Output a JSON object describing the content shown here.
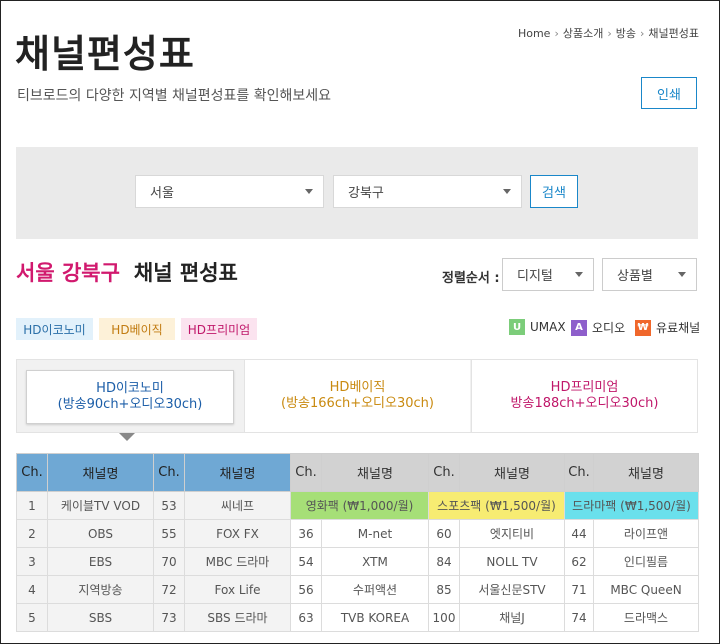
{
  "header": {
    "title": "채널편성표",
    "subtitle": "티브로드의 다양한 지역별 채널편성표를 확인해보세요",
    "breadcrumb": [
      "Home",
      "상품소개",
      "방송",
      "채널편성표"
    ],
    "print_label": "인쇄"
  },
  "search": {
    "city": "서울",
    "district": "강북구",
    "button": "검색"
  },
  "section": {
    "region": "서울 강북구",
    "label": "채널 편성표",
    "sort_label": "정렬순서 :",
    "sort_type": "디지털",
    "sort_group": "상품별"
  },
  "tags": [
    {
      "label": "HD이코노미",
      "bg": "#e2f1fb",
      "color": "#2a6fa8"
    },
    {
      "label": "HD베이직",
      "bg": "#fdf1d8",
      "color": "#c17b10"
    },
    {
      "label": "HD프리미엄",
      "bg": "#fbe3ef",
      "color": "#c0176a"
    }
  ],
  "legend": [
    {
      "glyph": "U",
      "label": "UMAX",
      "color": "#7ccd7a"
    },
    {
      "glyph": "A",
      "label": "오디오",
      "color": "#8e5fcb"
    },
    {
      "glyph": "₩",
      "label": "유료채널",
      "color": "#f0672b"
    }
  ],
  "tabs": [
    {
      "name": "HD이코노미",
      "detail": "(방송90ch+오디오30ch)",
      "color": "#1c5ea8",
      "active": true
    },
    {
      "name": "HD베이직",
      "detail": "(방송166ch+오디오30ch)",
      "color": "#c98a10",
      "active": false
    },
    {
      "name": "HD프리미엄",
      "detail": "방송188ch+오디오30ch)",
      "color": "#c0176a",
      "active": false
    }
  ],
  "chart_data": {
    "type": "table",
    "columns": [
      "Ch.",
      "채널명",
      "Ch.",
      "채널명",
      "Ch.",
      "채널명",
      "Ch.",
      "채널명",
      "Ch.",
      "채널명"
    ],
    "packages": [
      {
        "label": "영화팩 (₩1,000/월)",
        "color": "#a6df77"
      },
      {
        "label": "스포츠팩 (₩1,500/월)",
        "color": "#f7ec72"
      },
      {
        "label": "드라마팩 (₩1,500/월)",
        "color": "#6ae0ec"
      }
    ],
    "rows": [
      [
        "1",
        "케이블TV VOD",
        "53",
        "씨네프"
      ],
      [
        "2",
        "OBS",
        "55",
        "FOX FX",
        "36",
        "M-net",
        "60",
        "엣지티비",
        "44",
        "라이프앤"
      ],
      [
        "3",
        "EBS",
        "70",
        "MBC 드라마",
        "54",
        "XTM",
        "84",
        "NOLL TV",
        "62",
        "인디필름"
      ],
      [
        "4",
        "지역방송",
        "72",
        "Fox Life",
        "56",
        "수퍼액션",
        "85",
        "서울신문STV",
        "71",
        "MBC QueeN"
      ],
      [
        "5",
        "SBS",
        "73",
        "SBS 드라마",
        "63",
        "TVB KOREA",
        "100",
        "채널J",
        "74",
        "드라맥스"
      ]
    ]
  }
}
